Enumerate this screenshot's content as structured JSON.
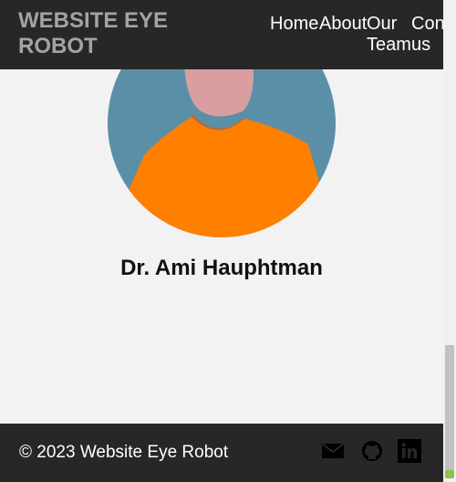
{
  "header": {
    "brand": "WEBSITE EYE ROBOT",
    "nav": [
      {
        "label": "Home"
      },
      {
        "label": "About"
      },
      {
        "label": "Our Team"
      },
      {
        "label": "Contact us"
      }
    ]
  },
  "profile": {
    "name": "Dr. Ami Hauphtman",
    "avatar_colors": {
      "background": "#5b8fa8",
      "shirt": "#ff7f00",
      "skin": "#d99ea0"
    }
  },
  "footer": {
    "copyright": "© 2023 Website Eye Robot",
    "social_icons": [
      "mail-icon",
      "github-icon",
      "linkedin-icon"
    ]
  }
}
